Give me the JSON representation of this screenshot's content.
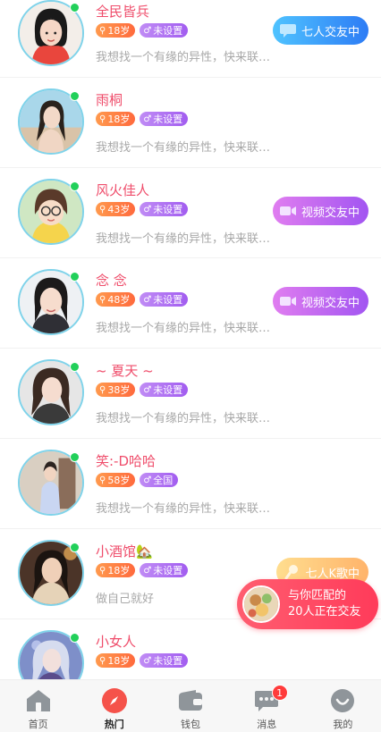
{
  "feed": [
    {
      "name": "全民皆兵",
      "age": "18岁",
      "gender": "未设置",
      "bio": "我想找一个有缘的异性，快来联…",
      "action": "七人交友中",
      "action_style": "blue",
      "action_icon": "chat-bubble-icon"
    },
    {
      "name": "雨桐",
      "age": "18岁",
      "gender": "未设置",
      "bio": "我想找一个有缘的异性，快来联…",
      "action": null
    },
    {
      "name": "风火佳人",
      "age": "43岁",
      "gender": "未设置",
      "bio": "我想找一个有缘的异性，快来联…",
      "action": "视频交友中",
      "action_style": "purple",
      "action_icon": "video-camera-icon"
    },
    {
      "name": "念 念",
      "age": "48岁",
      "gender": "未设置",
      "bio": "我想找一个有缘的异性，快来联…",
      "action": "视频交友中",
      "action_style": "purple",
      "action_icon": "video-camera-icon"
    },
    {
      "name": "~ 夏天 ~",
      "age": "38岁",
      "gender": "未设置",
      "bio": "我想找一个有缘的异性，快来联…",
      "action": null
    },
    {
      "name": "笑:-D哈哈",
      "age": "58岁",
      "gender": "全国",
      "bio": "我想找一个有缘的异性，快来联…",
      "action": null
    },
    {
      "name": "小酒馆🏡",
      "age": "18岁",
      "gender": "未设置",
      "bio": "做自己就好",
      "action": "七人K歌中",
      "action_style": "orange",
      "action_icon": "microphone-icon"
    },
    {
      "name": "小女人",
      "age": "18岁",
      "gender": "未设置",
      "bio": "",
      "action": null
    }
  ],
  "match_banner": {
    "line1": "与你匹配的",
    "line2": "20人正在交友"
  },
  "tabbar": {
    "tabs": [
      {
        "label": "首页",
        "icon": "home-icon"
      },
      {
        "label": "热门",
        "icon": "hot-compass-icon",
        "active": true
      },
      {
        "label": "钱包",
        "icon": "wallet-icon"
      },
      {
        "label": "消息",
        "icon": "message-icon",
        "badge": "1"
      },
      {
        "label": "我的",
        "icon": "profile-icon"
      }
    ]
  },
  "colors": {
    "name": "#ef4d6b",
    "online": "#22d05a",
    "accent": "#ff3b5a"
  }
}
